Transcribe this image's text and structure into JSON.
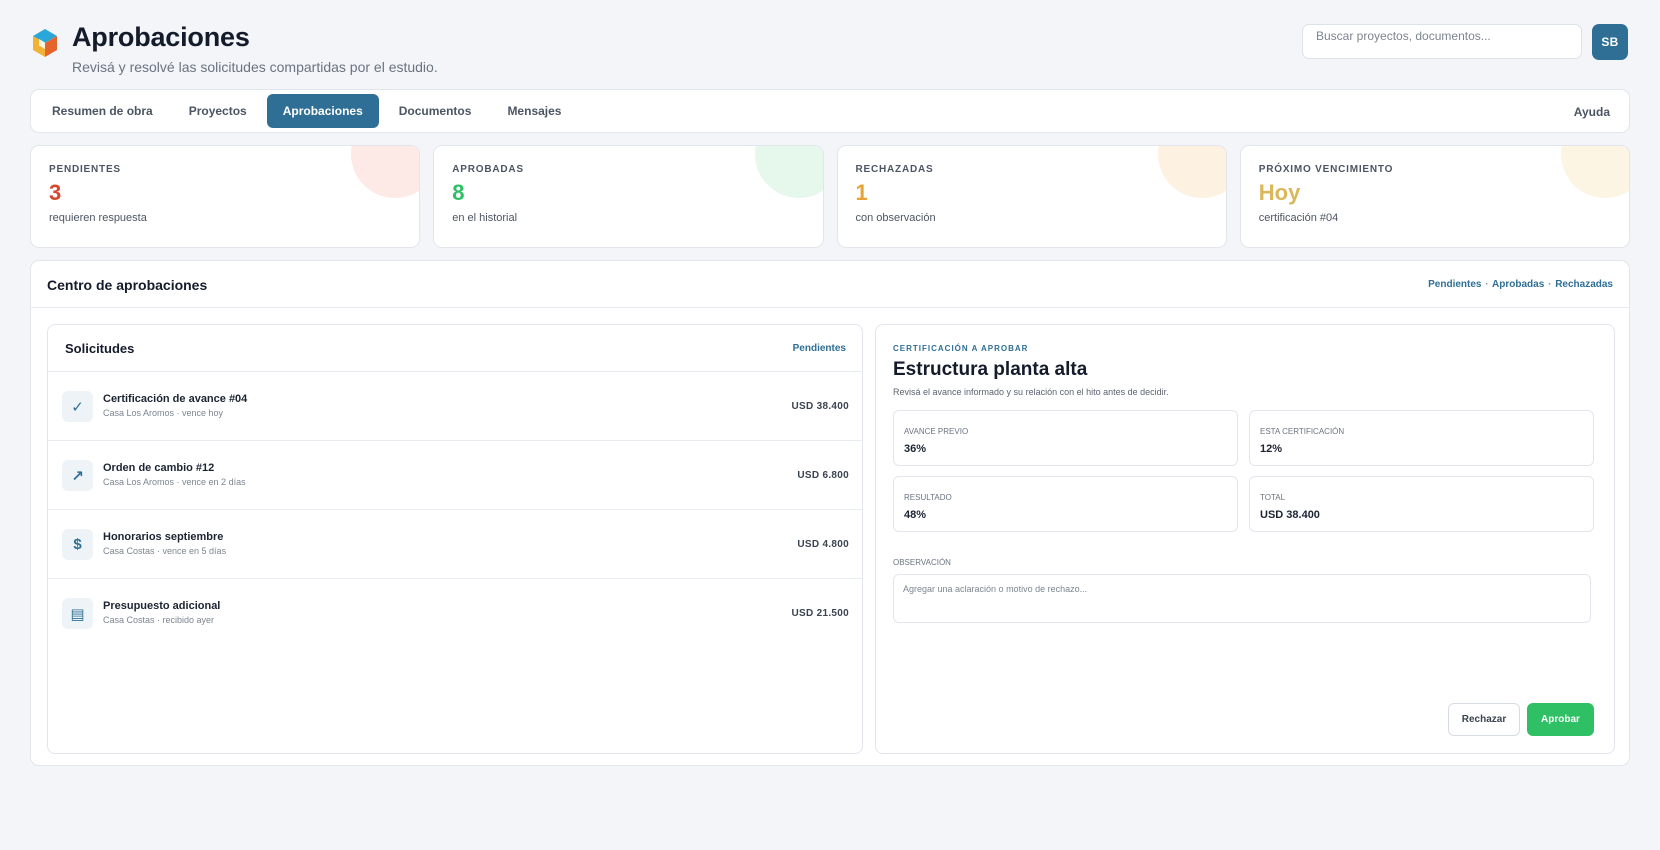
{
  "header": {
    "title": "Aprobaciones",
    "subtitle": "Revisá y resolvé las solicitudes compartidas por el estudio.",
    "search_placeholder": "Buscar proyectos, documentos...",
    "avatar_initials": "SB",
    "logo_icon": "cube-logo-icon"
  },
  "nav": {
    "tabs": [
      {
        "label": "Resumen de obra",
        "active": false
      },
      {
        "label": "Proyectos",
        "active": false
      },
      {
        "label": "Aprobaciones",
        "active": true
      },
      {
        "label": "Documentos",
        "active": false
      },
      {
        "label": "Mensajes",
        "active": false
      }
    ],
    "help": "Ayuda"
  },
  "stats": [
    {
      "label": "PENDIENTES",
      "value": "3",
      "note": "requieren respuesta",
      "color": "#d4482e",
      "blob": "#fdeae6"
    },
    {
      "label": "APROBADAS",
      "value": "8",
      "note": "en el historial",
      "color": "#2fbf64",
      "blob": "#e6f7ec"
    },
    {
      "label": "RECHAZADAS",
      "value": "1",
      "note": "con observación",
      "color": "#e6a437",
      "blob": "#fdf1e1"
    },
    {
      "label": "PRÓXIMO VENCIMIENTO",
      "value": "Hoy",
      "note": "certificación #04",
      "color": "#d9b75a",
      "blob": "#fcf5e4"
    }
  ],
  "panel": {
    "title": "Centro de aprobaciones",
    "filters": [
      "Pendientes",
      "Aprobadas",
      "Rechazadas"
    ],
    "filter_separator": "·"
  },
  "requests": {
    "title": "Solicitudes",
    "filter": "Pendientes",
    "items": [
      {
        "icon": "check-icon",
        "glyph": "✓",
        "name": "Certificación de avance #04",
        "meta": "Casa Los Aromos · vence hoy",
        "amount": "USD 38.400"
      },
      {
        "icon": "arrow-up-right-icon",
        "glyph": "↗",
        "name": "Orden de cambio #12",
        "meta": "Casa Los Aromos · vence en 2 días",
        "amount": "USD 6.800"
      },
      {
        "icon": "dollar-icon",
        "glyph": "$",
        "name": "Honorarios septiembre",
        "meta": "Casa Costas · vence en 5 días",
        "amount": "USD 4.800"
      },
      {
        "icon": "document-icon",
        "glyph": "▤",
        "name": "Presupuesto adicional",
        "meta": "Casa Costas · recibido ayer",
        "amount": "USD 21.500"
      }
    ]
  },
  "detail": {
    "eyebrow": "CERTIFICACIÓN A APROBAR",
    "title": "Estructura planta alta",
    "description": "Revisá el avance informado y su relación con el hito antes de decidir.",
    "metrics": [
      {
        "label": "Avance previo",
        "value": "36%"
      },
      {
        "label": "Esta certificación",
        "value": "12%"
      },
      {
        "label": "Resultado",
        "value": "48%"
      },
      {
        "label": "Total",
        "value": "USD 38.400"
      }
    ],
    "observation_label": "OBSERVACIÓN",
    "observation_placeholder": "Agregar una aclaración o motivo de rechazo...",
    "observation_value": "",
    "reject_label": "Rechazar",
    "approve_label": "Aprobar"
  }
}
